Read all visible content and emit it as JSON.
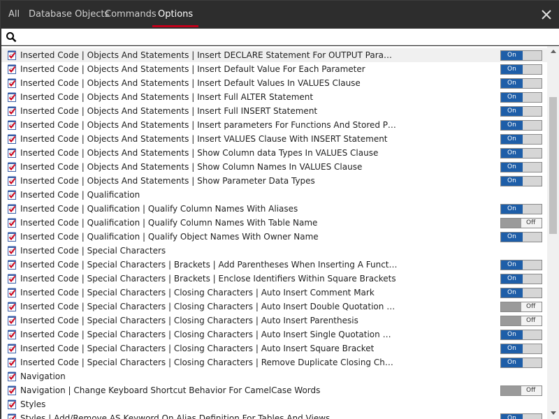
{
  "tabs": [
    {
      "label": "All",
      "active": false
    },
    {
      "label": "Database Objects",
      "active": false
    },
    {
      "label": "Commands",
      "active": false
    },
    {
      "label": "Options",
      "active": true
    }
  ],
  "search": {
    "value": "",
    "placeholder": ""
  },
  "colors": {
    "accent": "#c0001a",
    "toggle_on": "#1e5ea8",
    "titlebar": "#2d2d2d"
  },
  "toggle_labels": {
    "on": "On",
    "off": "Off"
  },
  "options": [
    {
      "label": "Inserted Code | Objects And Statements | Insert DECLARE Statement For OUTPUT Parameters",
      "state": "on",
      "selected": true
    },
    {
      "label": "Inserted Code | Objects And Statements | Insert Default Value For Each Parameter",
      "state": "on"
    },
    {
      "label": "Inserted Code | Objects And Statements | Insert Default Values In VALUES Clause",
      "state": "on"
    },
    {
      "label": "Inserted Code | Objects And Statements | Insert Full ALTER Statement",
      "state": "on"
    },
    {
      "label": "Inserted Code | Objects And Statements | Insert Full INSERT Statement",
      "state": "on"
    },
    {
      "label": "Inserted Code | Objects And Statements | Insert parameters For Functions And Stored Procedures",
      "state": "on"
    },
    {
      "label": "Inserted Code | Objects And Statements | Insert VALUES Clause With INSERT Statement",
      "state": "on"
    },
    {
      "label": "Inserted Code | Objects And Statements | Show Column data Types In VALUES Clause",
      "state": "on"
    },
    {
      "label": "Inserted Code | Objects And Statements | Show Column Names In VALUES Clause",
      "state": "on"
    },
    {
      "label": "Inserted Code | Objects And Statements | Show Parameter Data Types",
      "state": "on"
    },
    {
      "label": "Inserted Code | Qualification",
      "state": null
    },
    {
      "label": "Inserted Code | Qualification | Qualify Column Names With Aliases",
      "state": "on"
    },
    {
      "label": "Inserted Code | Qualification | Qualify Column Names With Table Name",
      "state": "off"
    },
    {
      "label": "Inserted Code | Qualification | Qualify Object Names With Owner Name",
      "state": "on"
    },
    {
      "label": "Inserted Code | Special Characters",
      "state": null
    },
    {
      "label": "Inserted Code | Special Characters | Brackets | Add Parentheses When Inserting A Function Or Datat...",
      "state": "on"
    },
    {
      "label": "Inserted Code | Special Characters | Brackets | Enclose Identifiers Within Square Brackets",
      "state": "on"
    },
    {
      "label": "Inserted Code | Special Characters | Closing Characters | Auto Insert Comment Mark",
      "state": "on"
    },
    {
      "label": "Inserted Code | Special Characters | Closing Characters | Auto Insert Double Quotation Mark",
      "state": "off"
    },
    {
      "label": "Inserted Code | Special Characters | Closing Characters | Auto Insert Parenthesis",
      "state": "off"
    },
    {
      "label": "Inserted Code | Special Characters | Closing Characters | Auto Insert Single Quotation Mark",
      "state": "on"
    },
    {
      "label": "Inserted Code | Special Characters | Closing Characters | Auto Insert Square Bracket",
      "state": "on"
    },
    {
      "label": "Inserted Code | Special Characters | Closing Characters | Remove Duplicate Closing Characters As Y...",
      "state": "on"
    },
    {
      "label": "Navigation",
      "state": null
    },
    {
      "label": "Navigation | Change Keyboard Shortcut Behavior For CamelCase Words",
      "state": "off"
    },
    {
      "label": "Styles",
      "state": null
    },
    {
      "label": "Styles | Add/Remove AS Keyword On Alias Definition For Tables And Views",
      "state": "on"
    }
  ]
}
